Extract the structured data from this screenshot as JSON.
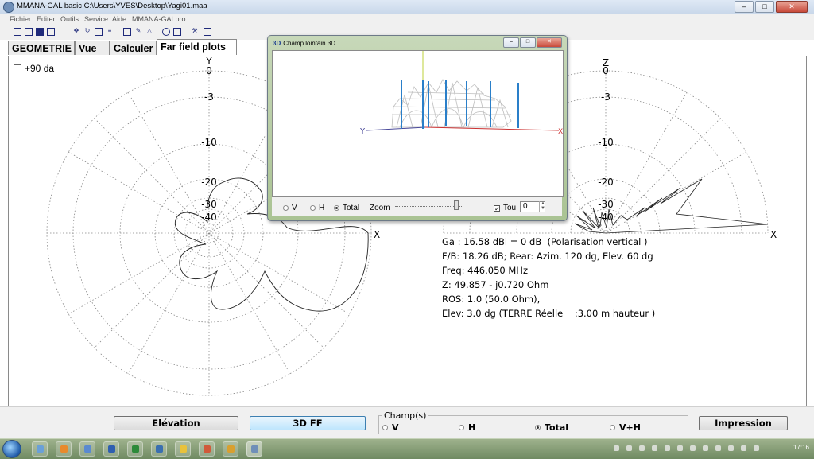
{
  "window": {
    "title": "MMANA-GAL basic  C:\\Users\\YVES\\Desktop\\Yagi01.maa",
    "controls": [
      "minimize-icon",
      "maximize-icon",
      "close-icon"
    ]
  },
  "menu": [
    "Fichier",
    "Editer",
    "Outils",
    "Service",
    "Aide",
    "MMANA-GALpro"
  ],
  "toolbar": [
    "new-file-icon",
    "open-folder-icon",
    "save-icon",
    "save-as-icon",
    "move-icon",
    "rotate-icon",
    "copy-icon",
    "edit-wires-icon",
    "document-icon",
    "draw-icon",
    "triangle-icon",
    "target-icon",
    "table-icon",
    "tools-icon",
    "calculator-icon"
  ],
  "tabs": [
    {
      "label": "GEOMETRIE",
      "active": false
    },
    {
      "label": "Vue",
      "active": false
    },
    {
      "label": "Calculer",
      "active": false
    },
    {
      "label": "Far field plots",
      "active": true
    }
  ],
  "checkbox90": {
    "label": "+90 da",
    "checked": false
  },
  "plots": {
    "left": {
      "axis_top": "Y",
      "axis_right": "X",
      "ring_labels": [
        "0",
        "-3",
        "-10",
        "-20",
        "-30",
        "-40"
      ]
    },
    "right": {
      "axis_top": "Z",
      "axis_right": "X",
      "ring_labels": [
        "0",
        "-3",
        "-10",
        "-20",
        "-30",
        "-40"
      ]
    }
  },
  "info": [
    "Ga : 16.58 dBi = 0 dB  (Polarisation vertical )",
    "F/B: 18.26 dB; Rear: Azim. 120 dg, Elev. 60 dg",
    "Freq: 446.050 MHz",
    "Z: 49.857 - j0.720 Ohm",
    "ROS: 1.0 (50.0 Ohm),",
    "Elev: 3.0 dg (TERRE Réelle    :3.00 m hauteur )"
  ],
  "bottom": {
    "elevation_button": "Elévation",
    "ff3d_button": "3D FF",
    "print_button": "Impression",
    "champs": {
      "legend": "Champ(s)",
      "options": [
        {
          "label": "V",
          "selected": false
        },
        {
          "label": "H",
          "selected": false
        },
        {
          "label": "Total",
          "selected": true
        },
        {
          "label": "V+H",
          "selected": false
        }
      ]
    }
  },
  "popup": {
    "badge": "3D",
    "title": "Champ lointain 3D",
    "axis_y": "Y",
    "axis_x": "X",
    "radios": [
      {
        "label": "V",
        "selected": false
      },
      {
        "label": "H",
        "selected": false
      },
      {
        "label": "Total",
        "selected": true
      }
    ],
    "zoom_label": "Zoom",
    "tou_label": "Tou",
    "tou_checked": true,
    "value": "0"
  },
  "taskbar": {
    "clock": "17:16"
  }
}
